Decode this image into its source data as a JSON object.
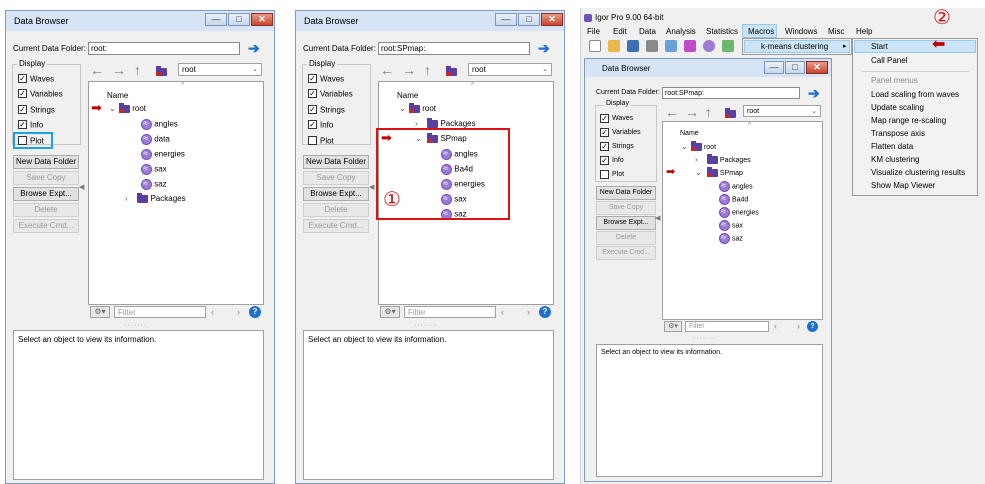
{
  "win1": {
    "title": "Data Browser",
    "current_label": "Current Data Folder:",
    "current_value": "root:",
    "display_label": "Display",
    "checkboxes": [
      {
        "label": "Waves",
        "checked": true
      },
      {
        "label": "Variables",
        "checked": true
      },
      {
        "label": "Strings",
        "checked": true
      },
      {
        "label": "Info",
        "checked": true
      },
      {
        "label": "Plot",
        "checked": false
      }
    ],
    "buttons": [
      "New Data Folder",
      "Save Copy",
      "Browse Expt...",
      "Delete",
      "Execute Cmd..."
    ],
    "folder_dd": "root",
    "name_header": "Name",
    "tree": [
      {
        "label": "root",
        "type": "folder"
      },
      {
        "label": "angles",
        "type": "wave"
      },
      {
        "label": "data",
        "type": "wave"
      },
      {
        "label": "energies",
        "type": "wave"
      },
      {
        "label": "sax",
        "type": "wave"
      },
      {
        "label": "saz",
        "type": "wave"
      },
      {
        "label": "Packages",
        "type": "folder"
      }
    ],
    "filter_placeholder": "Filter",
    "info_text": "Select an object to view its information."
  },
  "win2": {
    "title": "Data Browser",
    "current_label": "Current Data Folder:",
    "current_value": "root:SPmap:",
    "display_label": "Display",
    "checkboxes": [
      {
        "label": "Waves",
        "checked": true
      },
      {
        "label": "Variables",
        "checked": true
      },
      {
        "label": "Strings",
        "checked": true
      },
      {
        "label": "Info",
        "checked": true
      },
      {
        "label": "Plot",
        "checked": false
      }
    ],
    "buttons": [
      "New Data Folder",
      "Save Copy",
      "Browse Expt...",
      "Delete",
      "Execute Cmd..."
    ],
    "folder_dd": "root",
    "name_header": "Name",
    "tree": [
      {
        "label": "root",
        "type": "folder"
      },
      {
        "label": "Packages",
        "type": "folder"
      },
      {
        "label": "SPmap",
        "type": "folder"
      },
      {
        "label": "angles",
        "type": "wave"
      },
      {
        "label": "Ba4d",
        "type": "wave"
      },
      {
        "label": "energies",
        "type": "wave"
      },
      {
        "label": "sax",
        "type": "wave"
      },
      {
        "label": "saz",
        "type": "wave"
      }
    ],
    "filter_placeholder": "Filter",
    "info_text": "Select an object to view its information.",
    "annotation": "①"
  },
  "win3": {
    "app_title": "Igor Pro 9.00 64-bit",
    "menubar": [
      "File",
      "Edit",
      "Data",
      "Analysis",
      "Statistics",
      "Macros",
      "Windows",
      "Misc",
      "Help"
    ],
    "submenu_label": "k-means clustering",
    "menu_items": [
      "Start",
      "Call Panel",
      "Panel menus",
      "Load scaling from waves",
      "Update scaling",
      "Map range re-scaling",
      "Transpose axis",
      "Flatten data",
      "KM clustering",
      "Visualize clustering results",
      "Show Map Viewer"
    ],
    "annotation": "②",
    "browser": {
      "title": "Data Browser",
      "current_label": "Current Data Folder:",
      "current_value": "root:SPmap:",
      "display_label": "Display",
      "checkboxes": [
        {
          "label": "Waves",
          "checked": true
        },
        {
          "label": "Variables",
          "checked": true
        },
        {
          "label": "Strings",
          "checked": true
        },
        {
          "label": "Info",
          "checked": true
        },
        {
          "label": "Plot",
          "checked": false
        }
      ],
      "buttons": [
        "New Data Folder",
        "Save Copy",
        "Browse Expt...",
        "Delete",
        "Execute Cmd..."
      ],
      "folder_dd": "root",
      "name_header": "Name",
      "tree": [
        {
          "label": "root",
          "type": "folder"
        },
        {
          "label": "Packages",
          "type": "folder"
        },
        {
          "label": "SPmap",
          "type": "folder"
        },
        {
          "label": "angles",
          "type": "wave"
        },
        {
          "label": "Ba4d",
          "type": "wave"
        },
        {
          "label": "energies",
          "type": "wave"
        },
        {
          "label": "sax",
          "type": "wave"
        },
        {
          "label": "saz",
          "type": "wave"
        }
      ],
      "filter_placeholder": "Filter",
      "info_text": "Select an object to view its information."
    }
  },
  "colors": {
    "accent_blue": "#1f6fd0",
    "annotation_red": "#d11111",
    "highlight_cyan": "#18a3e6",
    "folder_purple": "#5a3fa0"
  }
}
